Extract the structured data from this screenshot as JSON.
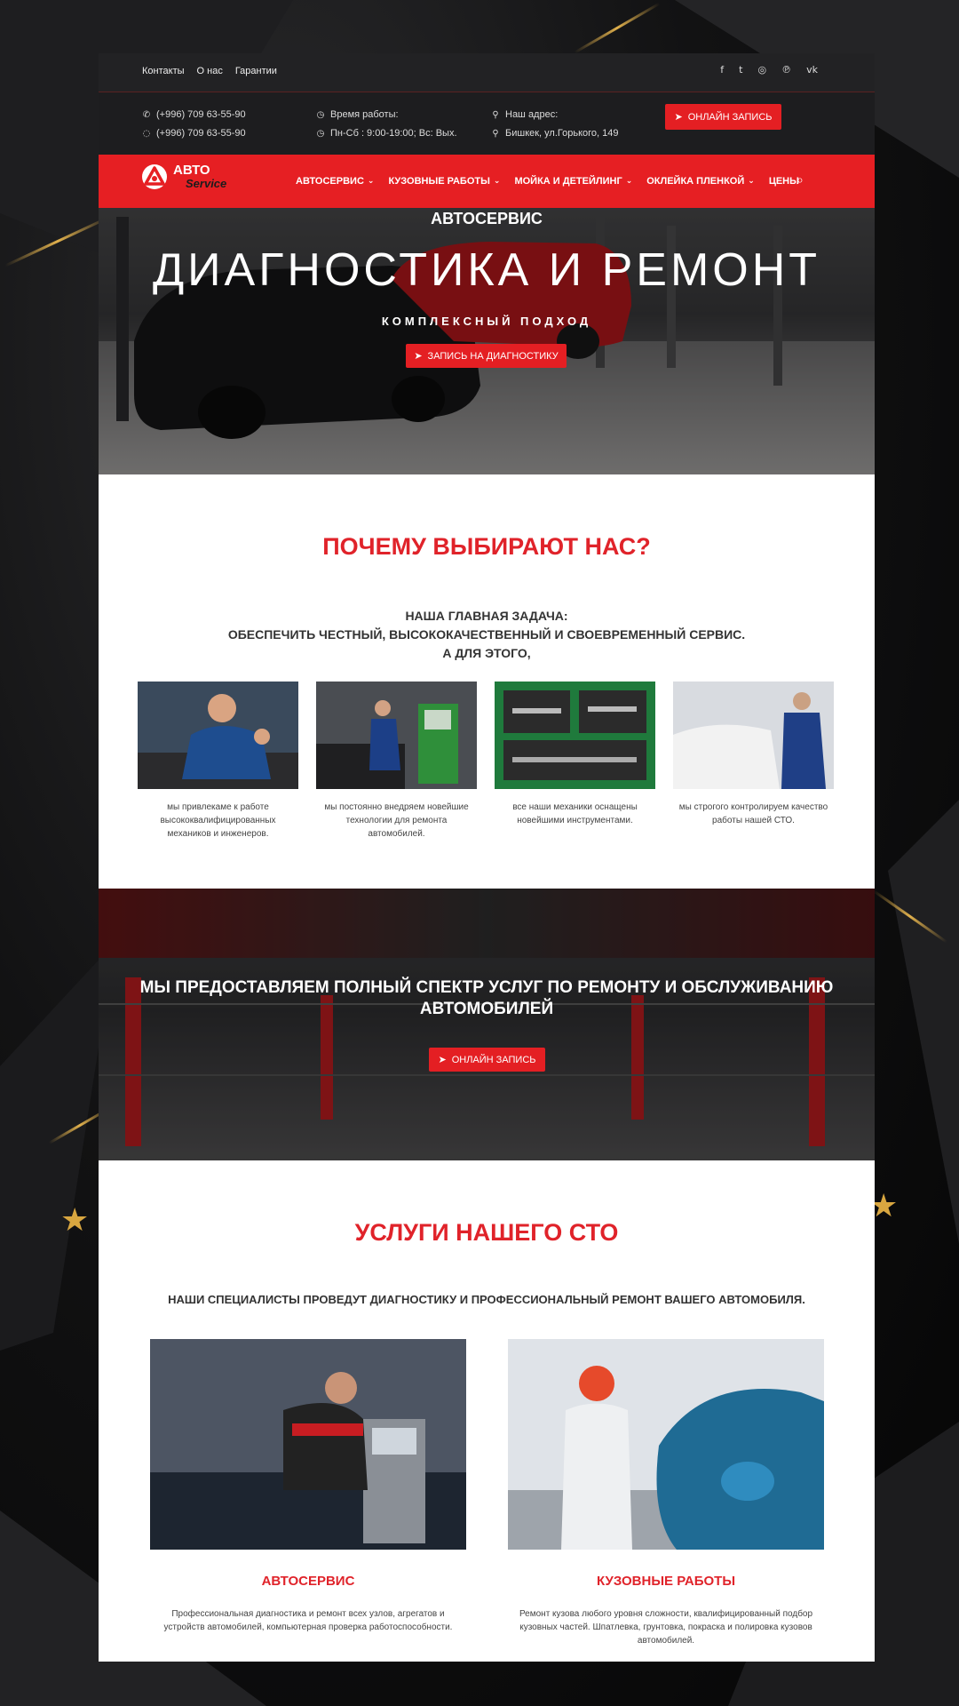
{
  "topbar": {
    "links": [
      "Контакты",
      "О нас",
      "Гарантии"
    ],
    "social_icons": [
      "facebook-icon",
      "twitter-icon",
      "instagram-icon",
      "pinterest-icon",
      "vk-icon"
    ]
  },
  "info": {
    "phone1": "(+996) 709 63-55-90",
    "phone2": "(+996) 709 63-55-90",
    "hours_label": "Время работы:",
    "hours_value": "Пн-Сб : 9:00-19:00; Вс: Вых.",
    "address_label": "Наш адрес:",
    "address_value": "Бишкек, ул.Горького, 149",
    "cta_label": "ОНЛАЙН ЗАПИСЬ"
  },
  "logo": {
    "line1": "АВТО",
    "line2": "Service"
  },
  "nav": {
    "items": [
      "АВТОСЕРВИС",
      "КУЗОВНЫЕ РАБОТЫ",
      "МОЙКА И ДЕТЕЙЛИНГ",
      "ОКЛЕЙКА ПЛЕНКОЙ",
      "ЦЕНЫ"
    ]
  },
  "hero": {
    "kicker": "АВТОСЕРВИС",
    "title": "ДИАГНОСТИКА И РЕМОНТ",
    "subtitle": "КОМПЛЕКСНЫЙ ПОДХОД",
    "cta_label": "ЗАПИСЬ НА ДИАГНОСТИКУ"
  },
  "why": {
    "title": "ПОЧЕМУ ВЫБИРАЮТ НАС?",
    "mission_line1": "НАША ГЛАВНАЯ ЗАДАЧА:",
    "mission_line2": "ОБЕСПЕЧИТЬ ЧЕСТНЫЙ, ВЫСОКОКАЧЕСТВЕННЫЙ И СВОЕВРЕМЕННЫЙ СЕРВИС.",
    "mission_line3": "А ДЛЯ ЭТОГО,",
    "cards": [
      "мы привлекаме к работе высококвалифицированных механиков и инженеров.",
      "мы постоянно внедряем новейшие технологии для ремонта автомобилей.",
      "все наши механики оснащены новейшими инструментами.",
      "мы строгого контролируем качество работы нашей СТО."
    ]
  },
  "banner": {
    "title": "МЫ ПРЕДОСТАВЛЯЕМ ПОЛНЫЙ СПЕКТР УСЛУГ ПО РЕМОНТУ И ОБСЛУЖИВАНИЮ АВТОМОБИЛЕЙ",
    "cta_label": "ОНЛАЙН ЗАПИСЬ"
  },
  "services": {
    "title": "УСЛУГИ НАШЕГО СТО",
    "lead": "НАШИ СПЕЦИАЛИСТЫ ПРОВЕДУТ ДИАГНОСТИКУ И ПРОФЕССИОНАЛЬНЫЙ РЕМОНТ ВАШЕГО АВТОМОБИЛЯ.",
    "items": [
      {
        "title": "АВТОСЕРВИС",
        "desc": "Профессиональная диагностика и ремонт всех узлов, агрегатов и устройств автомобилей, компьютерная проверка работоспособности."
      },
      {
        "title": "КУЗОВНЫЕ РАБОТЫ",
        "desc": "Ремонт кузова любого уровня сложности, квалифицированный подбор кузовных частей. Шпатлевка, грунтовка, покраска и полировка кузовов автомобилей."
      }
    ]
  },
  "colors": {
    "accent": "#e61f23",
    "dark": "#1d1d1f",
    "heading": "#e0232a",
    "gold": "#d8a640"
  }
}
